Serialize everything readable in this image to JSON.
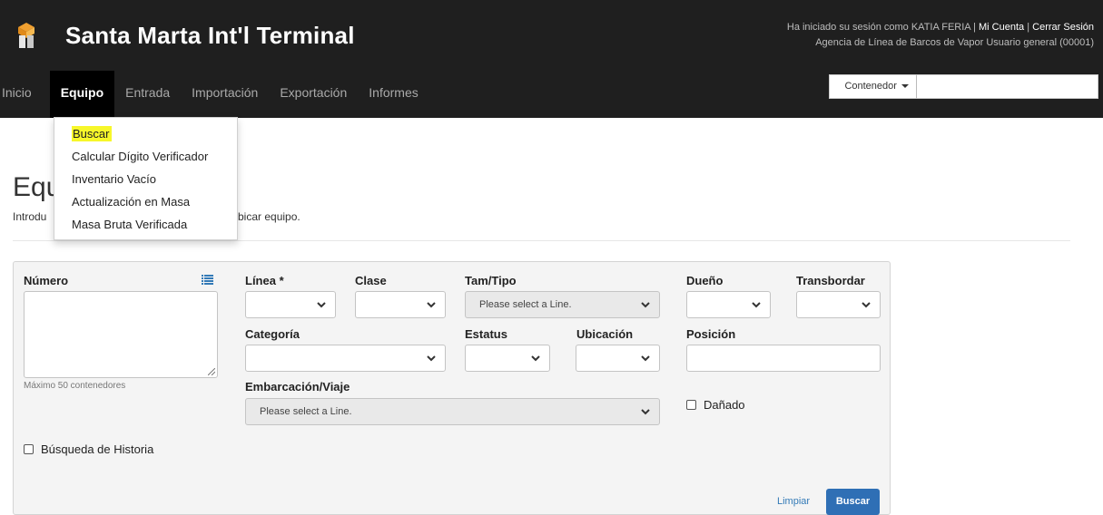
{
  "header": {
    "brand": "Santa Marta Int'l Terminal",
    "session_text": "Ha iniciado su sesión como KATIA FERIA | ",
    "my_account": "Mi Cuenta",
    "sep": " | ",
    "logout": "Cerrar Sesión",
    "agency": "Agencia de Línea de Barcos de Vapor Usuario general (00001)"
  },
  "nav": {
    "items": [
      "Inicio",
      "Equipo",
      "Entrada",
      "Importación",
      "Exportación",
      "Informes"
    ],
    "active": "Equipo"
  },
  "search": {
    "type_label": "Contenedor",
    "value": ""
  },
  "dropdown": {
    "items": [
      "Buscar",
      "Calcular Dígito Verificador",
      "Inventario Vacío",
      "Actualización en Masa",
      "Masa Bruta Verificada"
    ]
  },
  "page": {
    "title": "Equ",
    "subtitle_left": "Introdu",
    "subtitle_right": "bicar equipo."
  },
  "form": {
    "numero_label": "Número",
    "numero_hint": "Máximo 50 contenedores",
    "linea_label": "Línea *",
    "clase_label": "Clase",
    "tamtipo_label": "Tam/Tipo",
    "tamtipo_placeholder": "Please select a Line.",
    "dueno_label": "Dueño",
    "transbordar_label": "Transbordar",
    "categoria_label": "Categoría",
    "estatus_label": "Estatus",
    "ubicacion_label": "Ubicación",
    "posicion_label": "Posición",
    "embarcacion_label": "Embarcación/Viaje",
    "embarcacion_placeholder": "Please select a Line.",
    "danado_label": "Dañado",
    "historia_label": "Búsqueda de Historia",
    "clear_label": "Limpiar",
    "search_label": "Buscar"
  },
  "colors": {
    "topbar": "#1f1f1f",
    "highlight": "#f7f72a",
    "primary": "#2f6fb5",
    "link": "#337ab7"
  }
}
